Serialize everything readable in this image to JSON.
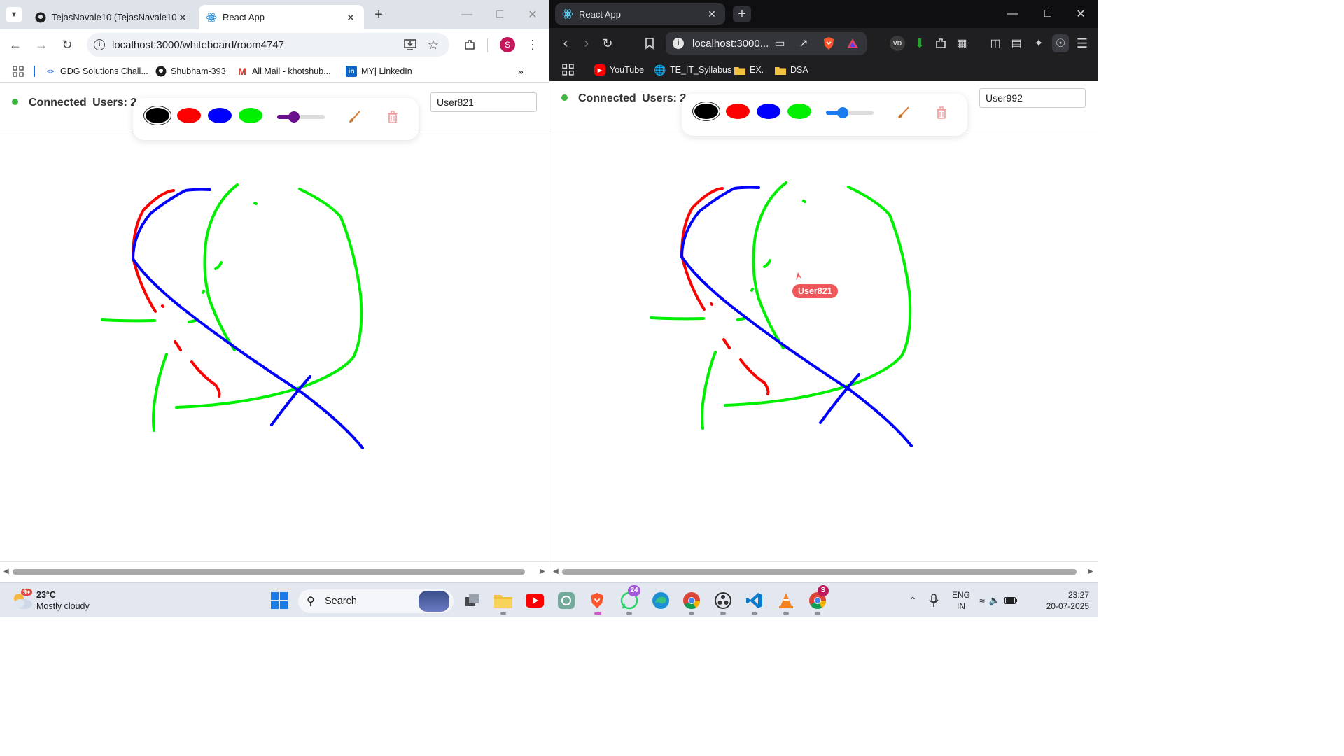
{
  "left_browser": {
    "tabs": [
      {
        "title": "TejasNavale10 (TejasNavale10) ·",
        "icon": "github-icon",
        "active": false
      },
      {
        "title": "React App",
        "icon": "react-icon",
        "active": true
      }
    ],
    "url": "localhost:3000/whiteboard/room4747",
    "profile_initial": "S",
    "bookmarks": [
      {
        "label": "GDG Solutions Chall...",
        "icon": "gdg-icon"
      },
      {
        "label": "Shubham-393",
        "icon": "github-icon"
      },
      {
        "label": "All Mail - khotshub...",
        "icon": "gmail-icon"
      },
      {
        "label": "MY| LinkedIn",
        "icon": "linkedin-icon"
      }
    ]
  },
  "right_browser": {
    "tab_title": "React App",
    "url": "localhost:3000...",
    "bookmarks": [
      {
        "label": "YouTube",
        "icon": "youtube-icon"
      },
      {
        "label": "TE_IT_Syllabus",
        "icon": "globe-icon"
      },
      {
        "label": "EX.",
        "icon": "folder-icon"
      },
      {
        "label": "DSA",
        "icon": "folder-icon"
      }
    ]
  },
  "whiteboard_left": {
    "status": "Connected",
    "users_label": "Users: 2",
    "username": "User821",
    "colors": [
      "#000000",
      "#ff0000",
      "#0000ff",
      "#00ee00"
    ],
    "selected_color": "#000000",
    "brush_accent": "#6b0f8f",
    "brush_size_level": 0.35
  },
  "whiteboard_right": {
    "status": "Connected",
    "users_label": "Users: 2",
    "username": "User992",
    "colors": [
      "#000000",
      "#ff0000",
      "#0000ff",
      "#00ee00"
    ],
    "selected_color": "#000000",
    "brush_accent": "#1a7cf0",
    "brush_size_level": 0.35,
    "remote_cursor_label": "User821"
  },
  "taskbar": {
    "weather_temp": "23°C",
    "weather_desc": "Mostly cloudy",
    "weather_badge": "9+",
    "search_placeholder": "Search",
    "whatsapp_badge": "24",
    "chrome_profile_badge": "S",
    "lang_top": "ENG",
    "lang_bottom": "IN",
    "time": "23:27",
    "date": "20-07-2025"
  }
}
